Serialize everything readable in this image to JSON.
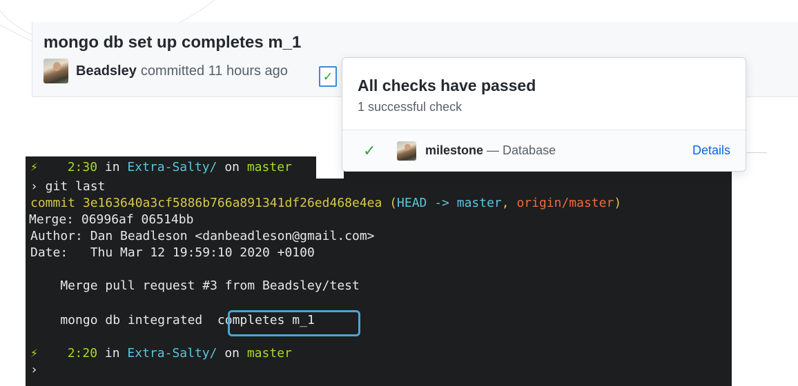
{
  "commit": {
    "title": "mongo db set up completes m_1",
    "author": "Beadsley",
    "committed_text": "committed 11 hours ago",
    "check_status_icon": "check-icon"
  },
  "checks_popover": {
    "title": "All checks have passed",
    "subtitle": "1 successful check",
    "checks": [
      {
        "status_icon": "check-icon",
        "name": "milestone",
        "description": "— Database",
        "details_label": "Details"
      }
    ]
  },
  "terminal": {
    "prompt1": {
      "icon": "plug-icon",
      "time": "2:30",
      "in_text": "in",
      "dir": "Extra-Salty/",
      "on_text": "on",
      "branch": "master"
    },
    "command": "› git last",
    "commit_line": {
      "prefix": "commit 3e163640a3cf5886b766a891341df26ed468e4ea",
      "open": "(",
      "head": "HEAD -> master",
      "comma": ",",
      "origin": "origin/master",
      "close": ")"
    },
    "merge_line": "Merge: 06996af 06514bb",
    "author_line": "Author: Dan Beadleson <danbeadleson@gmail.com>",
    "date_line": "Date:   Thu Mar 12 19:59:10 2020 +0100",
    "message_line1": "    Merge pull request #3 from Beadsley/test",
    "message_line2": "    mongo db integrated  completes m_1",
    "prompt2": {
      "icon": "plug-icon",
      "time": "2:20",
      "in_text": "in",
      "dir": "Extra-Salty/",
      "on_text": "on",
      "branch": "master"
    },
    "cursor_prompt": "›"
  },
  "colors": {
    "terminal_bg": "#1d1e1f",
    "green": "#a6da27",
    "cyan": "#5cc5de",
    "yellow": "#d8c84a",
    "orange": "#ef6a3e",
    "highlight": "#49a7d6",
    "link": "#0366d6",
    "success": "#28a745"
  }
}
